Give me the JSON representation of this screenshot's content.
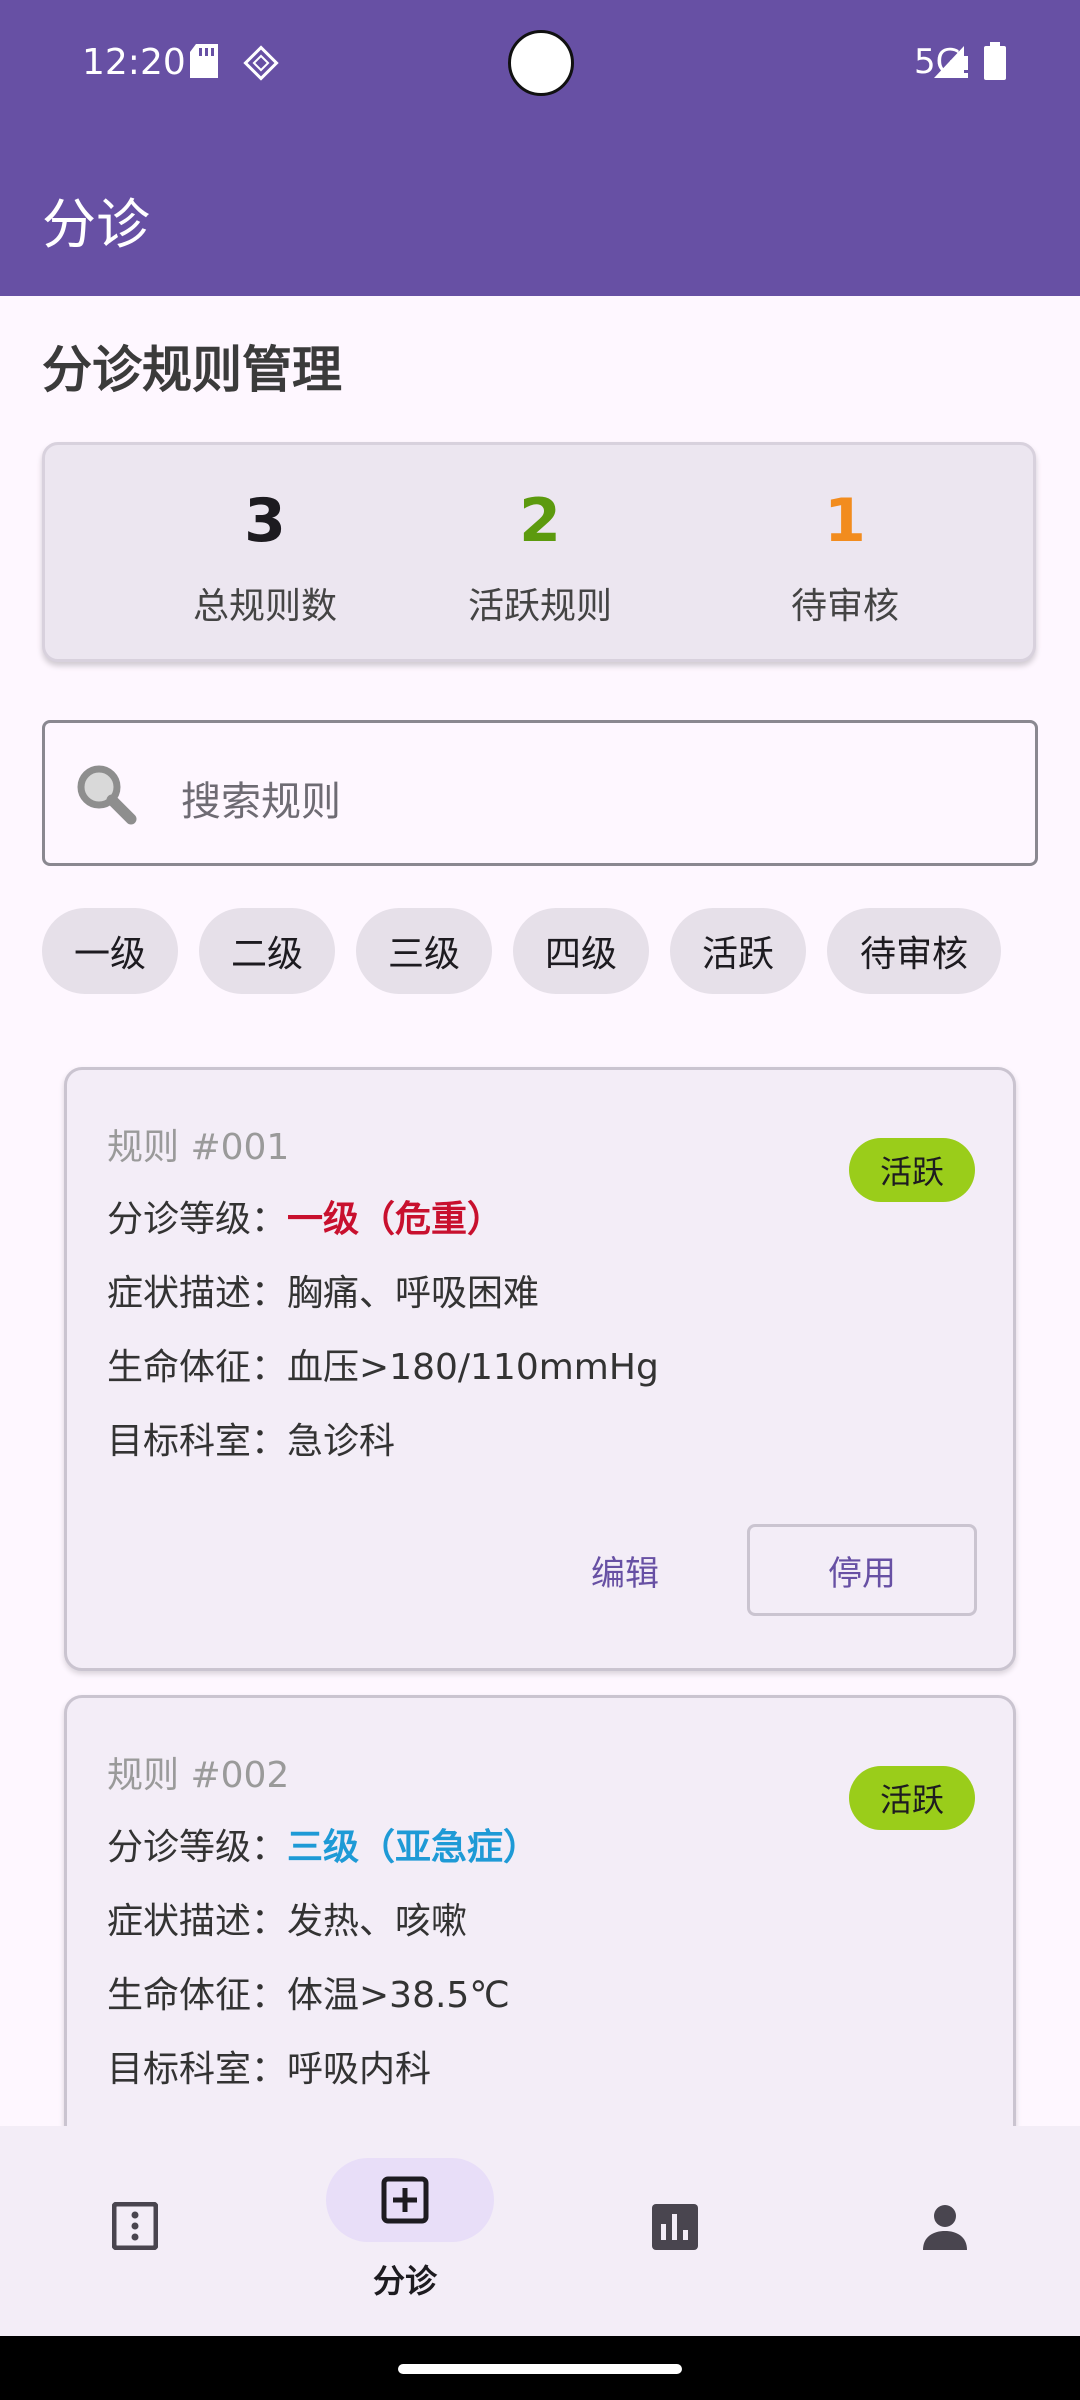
{
  "status_bar": {
    "time": "12:20",
    "network": "5G"
  },
  "app_bar": {
    "title": "分诊"
  },
  "page": {
    "title": "分诊规则管理"
  },
  "stats": [
    {
      "value": "3",
      "label": "总规则数",
      "color": "#111111"
    },
    {
      "value": "2",
      "label": "活跃规则",
      "color": "#5C9A0E"
    },
    {
      "value": "1",
      "label": "待审核",
      "color": "#F28C1E"
    }
  ],
  "search": {
    "placeholder": "搜索规则"
  },
  "filters": [
    "一级",
    "二级",
    "三级",
    "四级",
    "活跃",
    "待审核"
  ],
  "rules": [
    {
      "id": "规则 #001",
      "status": "活跃",
      "level_label": "分诊等级：",
      "level": "一级（危重）",
      "level_color": "#C8102E",
      "symptoms_label": "症状描述：",
      "symptoms": "胸痛、呼吸困难",
      "vitals_label": "生命体征：",
      "vitals": "血压>180/110mmHg",
      "dept_label": "目标科室：",
      "dept": "急诊科",
      "edit_label": "编辑",
      "disable_label": "停用"
    },
    {
      "id": "规则 #002",
      "status": "活跃",
      "level_label": "分诊等级：",
      "level": "三级（亚急症）",
      "level_color": "#1E9AD6",
      "symptoms_label": "症状描述：",
      "symptoms": "发热、咳嗽",
      "vitals_label": "生命体征：",
      "vitals": "体温>38.5℃",
      "dept_label": "目标科室：",
      "dept": "呼吸内科"
    }
  ],
  "bottom_nav": {
    "items": [
      {
        "icon": "list-icon",
        "label": ""
      },
      {
        "icon": "add-box-icon",
        "label": "分诊",
        "selected": true
      },
      {
        "icon": "bar-chart-icon",
        "label": ""
      },
      {
        "icon": "person-icon",
        "label": ""
      }
    ]
  },
  "colors": {
    "primary": "#6750A4",
    "badge": "#9ACD1A"
  }
}
